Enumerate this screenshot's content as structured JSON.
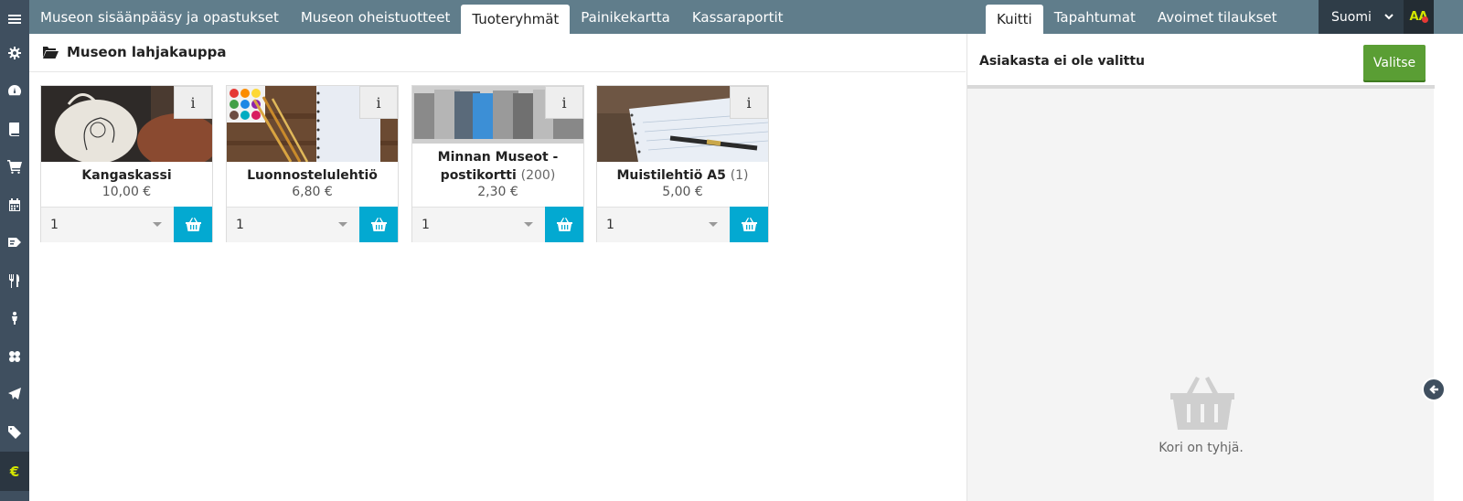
{
  "nav": {
    "tabs": [
      {
        "label": "Museon sisäänpääsy ja opastukset"
      },
      {
        "label": "Museon oheistuotteet"
      },
      {
        "label": "Tuoteryhmät"
      },
      {
        "label": "Painikekartta"
      },
      {
        "label": "Kassaraportit"
      }
    ],
    "right_tabs": [
      {
        "label": "Kuitti"
      },
      {
        "label": "Tapahtumat"
      },
      {
        "label": "Avoimet tilaukset"
      }
    ],
    "language": "Suomi",
    "font_size_toggle": "AA"
  },
  "sidebar": {
    "icons": [
      "menu-icon",
      "gear-icon",
      "dashboard-icon",
      "book-icon",
      "cart-icon",
      "calendar-icon",
      "tickets-icon",
      "restaurant-icon",
      "person-icon",
      "group-icon",
      "paper-plane-icon",
      "tag-icon",
      "euro-icon"
    ],
    "euro_symbol": "€"
  },
  "main": {
    "heading": "Museon lahjakauppa",
    "info_label": "i",
    "products": [
      {
        "name": "Kangaskassi",
        "count": "",
        "price": "10,00 €",
        "qty": "1"
      },
      {
        "name": "Luonnostelulehtiö",
        "count": "",
        "price": "6,80 €",
        "qty": "1"
      },
      {
        "name_line1": "Minnan Museot -",
        "name_line2": "postikortti",
        "count": "(200)",
        "price": "2,30 €",
        "qty": "1"
      },
      {
        "name": "Muistilehtiö A5",
        "count": "(1)",
        "price": "5,00 €",
        "qty": "1"
      }
    ]
  },
  "receipt": {
    "customer_status": "Asiakasta ei ole valittu",
    "select_button": "Valitse",
    "empty_text": "Kori on tyhjä."
  },
  "colors": {
    "topbar": "#607d8b",
    "rail": "#3f4f5f",
    "cart_button": "#03a9d1",
    "select_button": "#5a9e34",
    "accent_yellow": "#d4e600"
  }
}
